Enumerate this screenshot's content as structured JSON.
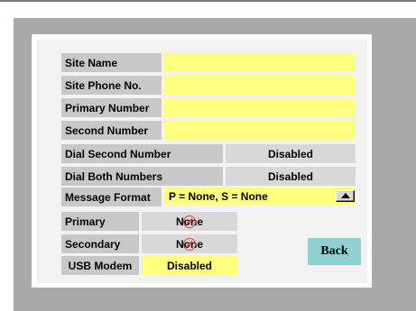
{
  "fields": {
    "site_name": {
      "label": "Site Name",
      "value": ""
    },
    "site_phone": {
      "label": "Site Phone No.",
      "value": ""
    },
    "primary_number": {
      "label": "Primary Number",
      "value": ""
    },
    "second_number": {
      "label": "Second Number",
      "value": ""
    }
  },
  "dial_second": {
    "label": "Dial Second Number",
    "value": "Disabled"
  },
  "dial_both": {
    "label": "Dial Both Numbers",
    "value": "Disabled"
  },
  "message_format": {
    "label": "Message Format",
    "value": "P = None, S = None",
    "icon": "scroll-up-arrow-icon"
  },
  "primary": {
    "label": "Primary",
    "value": "None",
    "icon": "no-entry-icon"
  },
  "secondary": {
    "label": "Secondary",
    "value": "None",
    "icon": "no-entry-icon"
  },
  "usb_modem": {
    "label": "USB Modem",
    "value": "Disabled"
  },
  "back_label": "Back",
  "colors": {
    "input_yellow": "#ffff80",
    "back_button": "#8fd1d1",
    "label_gray": "#c8c8c8"
  }
}
